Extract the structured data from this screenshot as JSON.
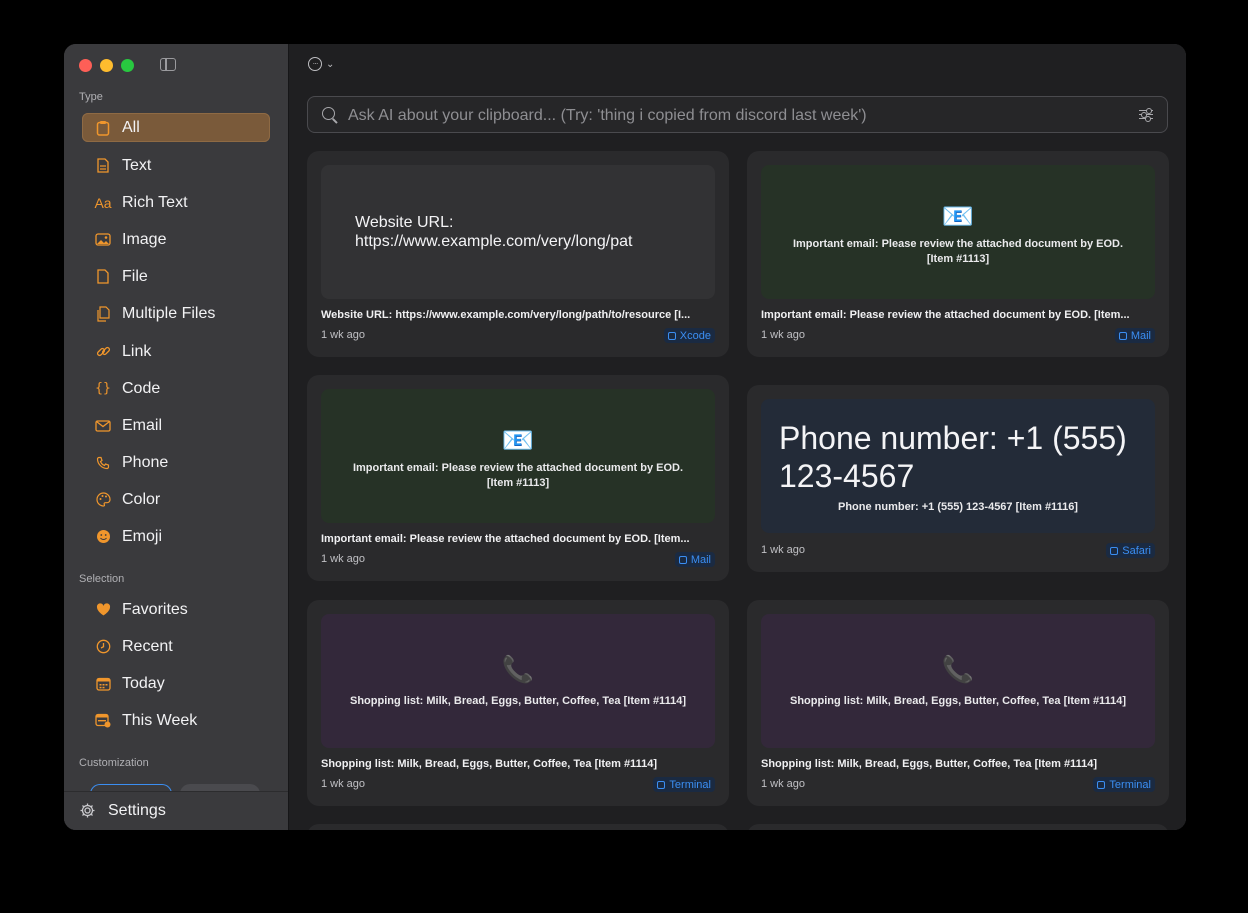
{
  "sidebar": {
    "type_label": "Type",
    "type_items": [
      {
        "label": "All",
        "icon": "clipboard-icon"
      },
      {
        "label": "Text",
        "icon": "document-text-icon"
      },
      {
        "label": "Rich Text",
        "icon": "rich-text-icon",
        "glyph": "Aa"
      },
      {
        "label": "Image",
        "icon": "image-icon"
      },
      {
        "label": "File",
        "icon": "file-icon"
      },
      {
        "label": "Multiple Files",
        "icon": "multiple-files-icon"
      },
      {
        "label": "Link",
        "icon": "link-icon"
      },
      {
        "label": "Code",
        "icon": "code-braces-icon",
        "glyph": "{}"
      },
      {
        "label": "Email",
        "icon": "envelope-icon"
      },
      {
        "label": "Phone",
        "icon": "phone-icon"
      },
      {
        "label": "Color",
        "icon": "palette-icon"
      },
      {
        "label": "Emoji",
        "icon": "smiley-icon"
      }
    ],
    "selection_label": "Selection",
    "selection_items": [
      {
        "label": "Favorites",
        "icon": "heart-icon"
      },
      {
        "label": "Recent",
        "icon": "clock-icon"
      },
      {
        "label": "Today",
        "icon": "calendar-today-icon"
      },
      {
        "label": "This Week",
        "icon": "calendar-week-icon"
      }
    ],
    "customization_label": "Customization",
    "settings_label": "Settings",
    "accent_color": "#f0962c"
  },
  "search": {
    "placeholder": "Ask AI about your clipboard... (Try: 'thing i copied from discord last week')"
  },
  "cards": [
    {
      "preview_text": "Website URL: https://www.example.com/very/long/pat",
      "title": "Website URL: https://www.example.com/very/long/path/to/resource [I...",
      "time": "1 wk ago",
      "app": "Xcode"
    },
    {
      "preview_text": "Important email: Please review the attached document by EOD. [Item #1113]",
      "title": "Important email: Please review the attached document by EOD. [Item...",
      "time": "1 wk ago",
      "app": "Mail"
    },
    {
      "preview_text": "Important email: Please review the attached document by EOD. [Item #1113]",
      "title": "Important email: Please review the attached document by EOD. [Item...",
      "time": "1 wk ago",
      "app": "Mail"
    },
    {
      "preview_big": "Phone number: +1 (555) 123-4567",
      "preview_text": "Phone number: +1 (555) 123-4567 [Item #1116]",
      "time": "1 wk ago",
      "app": "Safari"
    },
    {
      "preview_text": "Shopping list: Milk, Bread, Eggs, Butter, Coffee, Tea [Item #1114]",
      "title": "Shopping list: Milk, Bread, Eggs, Butter, Coffee, Tea [Item #1114]",
      "time": "1 wk ago",
      "app": "Terminal"
    },
    {
      "preview_text": "Shopping list: Milk, Bread, Eggs, Butter, Coffee, Tea [Item #1114]",
      "title": "Shopping list: Milk, Bread, Eggs, Butter, Coffee, Tea [Item #1114]",
      "time": "1 wk ago",
      "app": "Terminal"
    }
  ]
}
